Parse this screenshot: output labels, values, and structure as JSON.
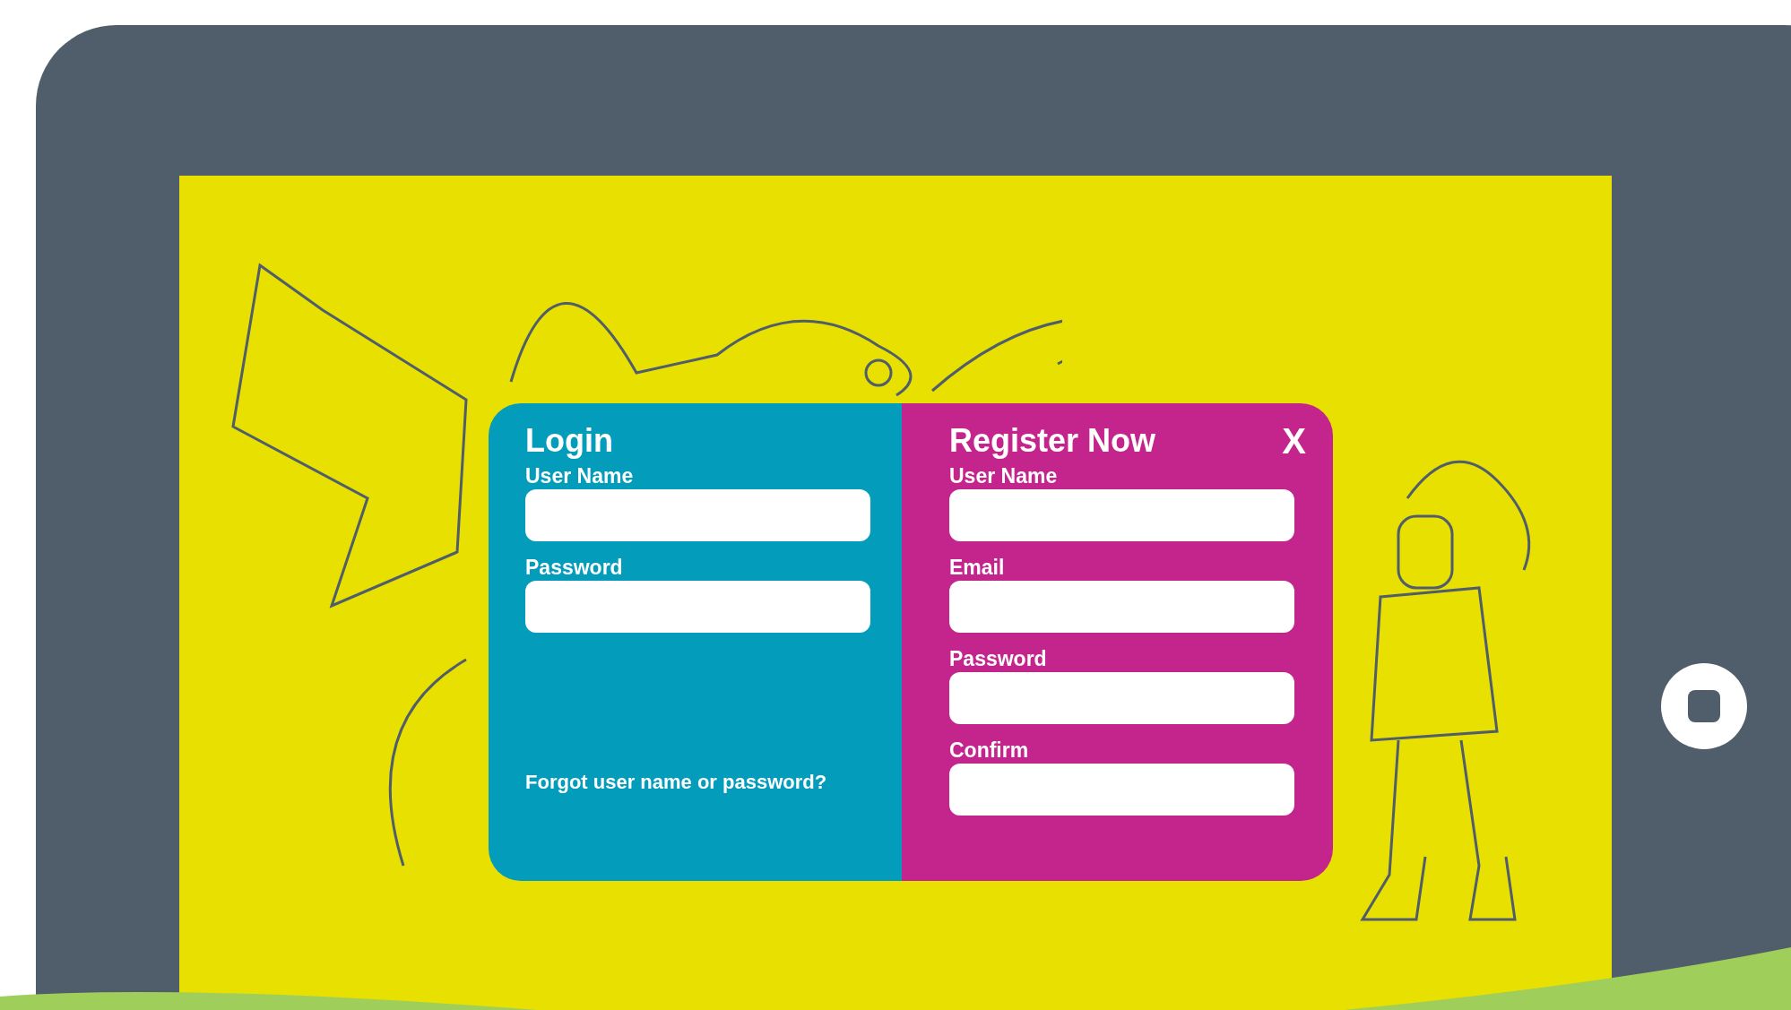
{
  "login": {
    "title": "Login",
    "fields": [
      {
        "label": "User Name"
      },
      {
        "label": "Password"
      }
    ],
    "forgot_link": "Forgot user name or password?"
  },
  "register": {
    "title": "Register Now",
    "close": "X",
    "fields": [
      {
        "label": "User Name"
      },
      {
        "label": "Email"
      },
      {
        "label": "Password"
      },
      {
        "label": "Confirm"
      }
    ]
  }
}
